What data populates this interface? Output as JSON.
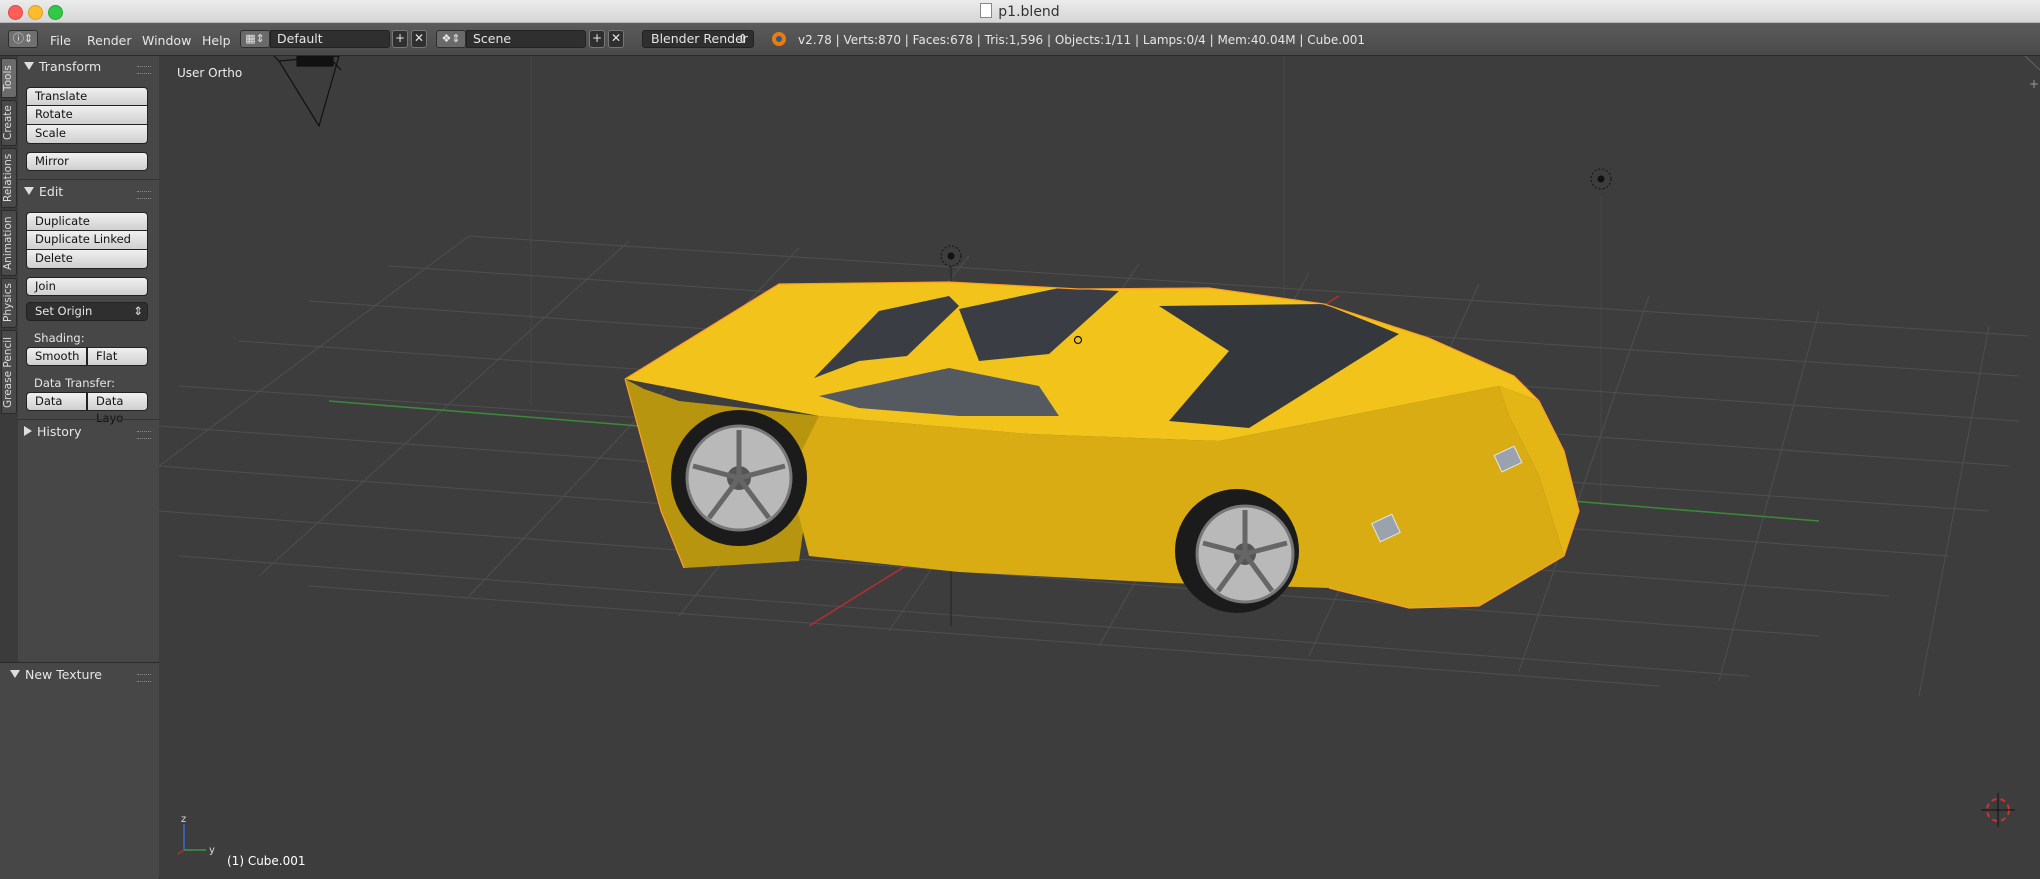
{
  "window": {
    "title": "p1.blend"
  },
  "header": {
    "menus": [
      "File",
      "Render",
      "Window",
      "Help"
    ],
    "layout": "Default",
    "scene": "Scene",
    "render_engine": "Blender Render",
    "stats": "v2.78 | Verts:870 | Faces:678 | Tris:1,596 | Objects:1/11 | Lamps:0/4 | Mem:40.04M | Cube.001"
  },
  "tabs": [
    "Tools",
    "Create",
    "Relations",
    "Animation",
    "Physics",
    "Grease Pencil"
  ],
  "toolshelf": {
    "transform": {
      "title": "Transform",
      "translate": "Translate",
      "rotate": "Rotate",
      "scale": "Scale",
      "mirror": "Mirror"
    },
    "edit": {
      "title": "Edit",
      "duplicate": "Duplicate",
      "duplicate_linked": "Duplicate Linked",
      "delete": "Delete",
      "join": "Join",
      "set_origin": "Set Origin",
      "shading_label": "Shading:",
      "smooth": "Smooth",
      "flat": "Flat",
      "data_transfer_label": "Data Transfer:",
      "data": "Data",
      "data_layout": "Data Layo"
    },
    "history": {
      "title": "History"
    },
    "new_texture": {
      "title": "New Texture"
    }
  },
  "viewport": {
    "view_label": "User Ortho",
    "object_label": "(1) Cube.001",
    "axis_z": "z",
    "axis_y": "y"
  },
  "colors": {
    "car_body": "#f2c31a",
    "grid": "#4f4f4f",
    "x_axis": "#b03030",
    "y_axis": "#3a8a3a"
  }
}
